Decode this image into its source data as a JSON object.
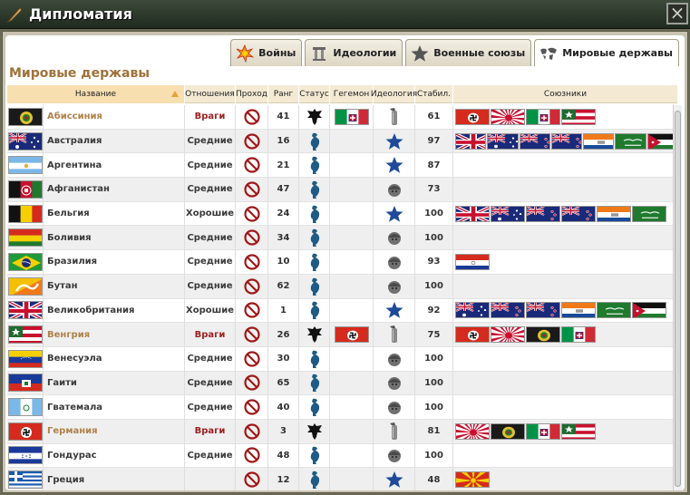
{
  "window": {
    "title": "Дипломатия"
  },
  "tabs": [
    {
      "label": "Войны",
      "icon": "explosion-icon"
    },
    {
      "label": "Идеологии",
      "icon": "pillar-icon"
    },
    {
      "label": "Военные союзы",
      "icon": "star-icon"
    },
    {
      "label": "Мировые державы",
      "icon": "world-map-icon",
      "active": true
    }
  ],
  "section_title": "Мировые державы",
  "columns": {
    "name": "Название",
    "relations": "Отношения",
    "passage": "Проход",
    "rank": "Ранг",
    "status": "Статус",
    "hegemon": "Гегемон",
    "ideology": "Идеология",
    "stability": "Стабил.",
    "allies": "Союзники"
  },
  "rows": [
    {
      "name": "Абиссиния",
      "enemy": true,
      "flag": "abyssinia",
      "relations": "Враги",
      "rank": "41",
      "status": "black-eagle",
      "hegemon": "italy",
      "ideology": "fasces",
      "stability": "61",
      "allies": [
        "germany",
        "japan",
        "italy",
        "hungary"
      ]
    },
    {
      "name": "Австралия",
      "flag": "australia",
      "relations": "Средние",
      "rank": "16",
      "status": "blue-eagle",
      "hegemon": "",
      "ideology": "star",
      "stability": "97",
      "allies": [
        "uk",
        "australia",
        "nz",
        "nz",
        "southafrica",
        "saudi",
        "jordan"
      ]
    },
    {
      "name": "Аргентина",
      "flag": "argentina",
      "relations": "Средние",
      "rank": "21",
      "status": "blue-eagle",
      "hegemon": "",
      "ideology": "star",
      "stability": "87",
      "allies": []
    },
    {
      "name": "Афганистан",
      "flag": "afghanistan",
      "relations": "Средние",
      "rank": "47",
      "status": "blue-eagle",
      "hegemon": "",
      "ideology": "helmet",
      "stability": "73",
      "allies": []
    },
    {
      "name": "Бельгия",
      "flag": "belgium",
      "relations": "Хорошие",
      "rank": "24",
      "status": "blue-eagle",
      "hegemon": "",
      "ideology": "star",
      "stability": "100",
      "allies": [
        "uk",
        "australia",
        "nz",
        "nz",
        "southafrica",
        "saudi"
      ]
    },
    {
      "name": "Боливия",
      "flag": "bolivia",
      "relations": "Средние",
      "rank": "34",
      "status": "blue-eagle",
      "hegemon": "",
      "ideology": "helmet",
      "stability": "100",
      "allies": []
    },
    {
      "name": "Бразилия",
      "flag": "brazil",
      "relations": "Средние",
      "rank": "10",
      "status": "blue-eagle",
      "hegemon": "",
      "ideology": "helmet",
      "stability": "93",
      "allies": [
        "paraguay"
      ]
    },
    {
      "name": "Бутан",
      "flag": "bhutan",
      "relations": "Средние",
      "rank": "62",
      "status": "blue-eagle",
      "hegemon": "",
      "ideology": "helmet",
      "stability": "100",
      "allies": []
    },
    {
      "name": "Великобритания",
      "flag": "uk",
      "relations": "Хорошие",
      "rank": "1",
      "status": "blue-eagle",
      "hegemon": "",
      "ideology": "star",
      "stability": "92",
      "allies": [
        "australia",
        "nz",
        "nz",
        "southafrica",
        "saudi",
        "jordan"
      ]
    },
    {
      "name": "Венгрия",
      "enemy": true,
      "flag": "hungary",
      "relations": "Враги",
      "rank": "26",
      "status": "black-eagle",
      "hegemon": "germany",
      "ideology": "fasces",
      "stability": "75",
      "allies": [
        "germany",
        "japan",
        "abyssinia",
        "italy"
      ]
    },
    {
      "name": "Венесуэла",
      "flag": "venezuela",
      "relations": "Средние",
      "rank": "30",
      "status": "blue-eagle",
      "hegemon": "",
      "ideology": "helmet",
      "stability": "100",
      "allies": []
    },
    {
      "name": "Гаити",
      "flag": "haiti",
      "relations": "Средние",
      "rank": "65",
      "status": "blue-eagle",
      "hegemon": "",
      "ideology": "helmet",
      "stability": "100",
      "allies": []
    },
    {
      "name": "Гватемала",
      "flag": "guatemala",
      "relations": "Средние",
      "rank": "40",
      "status": "blue-eagle",
      "hegemon": "",
      "ideology": "helmet",
      "stability": "100",
      "allies": []
    },
    {
      "name": "Германия",
      "enemy": true,
      "flag": "germany",
      "relations": "Враги",
      "rank": "3",
      "status": "black-eagle",
      "hegemon": "",
      "ideology": "fasces",
      "stability": "81",
      "allies": [
        "japan",
        "abyssinia",
        "italy",
        "hungary"
      ]
    },
    {
      "name": "Гондурас",
      "flag": "honduras",
      "relations": "Средние",
      "rank": "48",
      "status": "blue-eagle",
      "hegemon": "",
      "ideology": "helmet",
      "stability": "100",
      "allies": []
    },
    {
      "name": "Греция",
      "flag": "greece",
      "relations": "",
      "rank": "12",
      "status": "blue-eagle",
      "hegemon": "",
      "ideology": "star",
      "stability": "48",
      "allies": [
        "macedonia"
      ]
    }
  ]
}
